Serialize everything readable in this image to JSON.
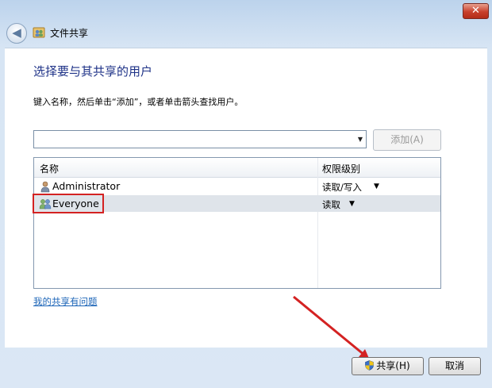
{
  "window": {
    "close_glyph": "✕",
    "title": "文件共享",
    "back_glyph": "◀"
  },
  "main": {
    "heading": "选择要与其共享的用户",
    "instruction": "键入名称，然后单击“添加”，或者单击箭头查找用户。",
    "combo_value": "",
    "add_button": "添加(A)"
  },
  "table": {
    "columns": [
      "名称",
      "权限级别"
    ],
    "rows": [
      {
        "name": "Administrator",
        "permission": "读取/写入",
        "icon": "user-icon"
      },
      {
        "name": "Everyone",
        "permission": "读取",
        "icon": "users-group-icon"
      }
    ]
  },
  "help_link": "我的共享有问题",
  "buttons": {
    "share": "共享(H)",
    "cancel": "取消"
  },
  "colors": {
    "heading": "#1e3287",
    "highlight": "#d42222",
    "link": "#1e66b8"
  }
}
